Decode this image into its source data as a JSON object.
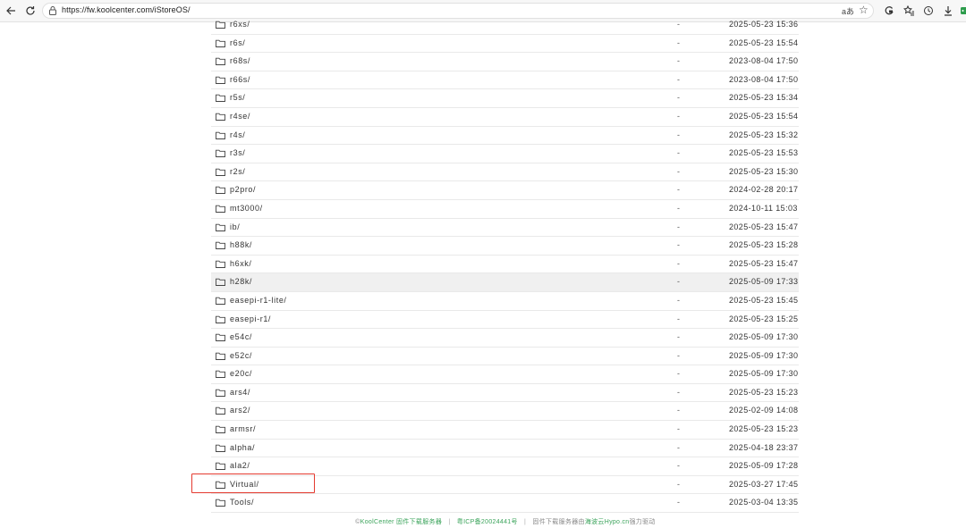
{
  "browser": {
    "url": "https://fw.koolcenter.com/iStoreOS/",
    "translate_label": "aあ"
  },
  "listing": {
    "rows": [
      {
        "name": "r6xs/",
        "size": "-",
        "date": "2025-05-23 15:36"
      },
      {
        "name": "r6s/",
        "size": "-",
        "date": "2025-05-23 15:54"
      },
      {
        "name": "r68s/",
        "size": "-",
        "date": "2023-08-04 17:50"
      },
      {
        "name": "r66s/",
        "size": "-",
        "date": "2023-08-04 17:50"
      },
      {
        "name": "r5s/",
        "size": "-",
        "date": "2025-05-23 15:34"
      },
      {
        "name": "r4se/",
        "size": "-",
        "date": "2025-05-23 15:54"
      },
      {
        "name": "r4s/",
        "size": "-",
        "date": "2025-05-23 15:32"
      },
      {
        "name": "r3s/",
        "size": "-",
        "date": "2025-05-23 15:53"
      },
      {
        "name": "r2s/",
        "size": "-",
        "date": "2025-05-23 15:30"
      },
      {
        "name": "p2pro/",
        "size": "-",
        "date": "2024-02-28 20:17"
      },
      {
        "name": "mt3000/",
        "size": "-",
        "date": "2024-10-11 15:03"
      },
      {
        "name": "ib/",
        "size": "-",
        "date": "2025-05-23 15:47"
      },
      {
        "name": "h88k/",
        "size": "-",
        "date": "2025-05-23 15:28"
      },
      {
        "name": "h6xk/",
        "size": "-",
        "date": "2025-05-23 15:47"
      },
      {
        "name": "h28k/",
        "size": "-",
        "date": "2025-05-09 17:33"
      },
      {
        "name": "easepi-r1-lite/",
        "size": "-",
        "date": "2025-05-23 15:45"
      },
      {
        "name": "easepi-r1/",
        "size": "-",
        "date": "2025-05-23 15:25"
      },
      {
        "name": "e54c/",
        "size": "-",
        "date": "2025-05-09 17:30"
      },
      {
        "name": "e52c/",
        "size": "-",
        "date": "2025-05-09 17:30"
      },
      {
        "name": "e20c/",
        "size": "-",
        "date": "2025-05-09 17:30"
      },
      {
        "name": "ars4/",
        "size": "-",
        "date": "2025-05-23 15:23"
      },
      {
        "name": "ars2/",
        "size": "-",
        "date": "2025-02-09 14:08"
      },
      {
        "name": "armsr/",
        "size": "-",
        "date": "2025-05-23 15:23"
      },
      {
        "name": "alpha/",
        "size": "-",
        "date": "2025-04-18 23:37"
      },
      {
        "name": "ala2/",
        "size": "-",
        "date": "2025-05-09 17:28"
      },
      {
        "name": "Virtual/",
        "size": "-",
        "date": "2025-03-27 17:45"
      },
      {
        "name": "Tools/",
        "size": "-",
        "date": "2025-03-04 13:35"
      }
    ],
    "hovered_row": "h28k/",
    "highlighted_row": "Virtual/"
  },
  "footer": {
    "copyright_prefix": "©",
    "brand": "KoolCenter 固件下载服务器",
    "icp": "粤ICP备20024441号",
    "hosting_prefix": "固件下载服务器由",
    "host_name": "海波云Hypo.cn",
    "hosting_suffix": "强力驱动"
  },
  "colors": {
    "link_green": "#3aa35a",
    "highlight_red": "#e43a2f",
    "hover_row": "#f0f0f0"
  }
}
